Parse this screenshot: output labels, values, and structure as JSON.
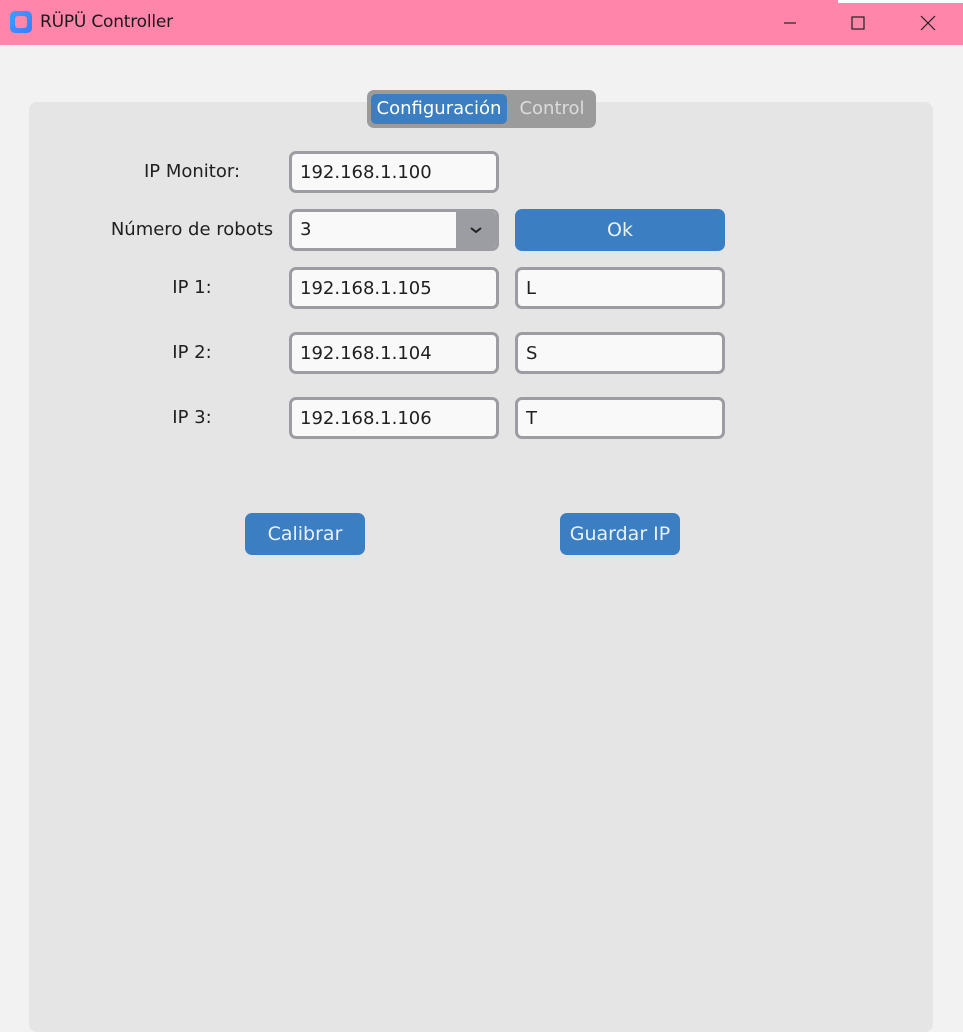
{
  "window": {
    "title": "RÜPÜ Controller",
    "icon": "app-icon",
    "controls": [
      "minimize-icon",
      "maximize-icon",
      "close-icon"
    ]
  },
  "tabs": {
    "active": "Configuración",
    "inactive": "Control"
  },
  "config": {
    "ip_monitor_label": "IP Monitor:",
    "ip_monitor_value": "192.168.1.100",
    "num_robots_label": "Número de robots",
    "num_robots_value": "3",
    "ok_label": "Ok",
    "robots": [
      {
        "label": "IP 1:",
        "ip": "192.168.1.105",
        "letter": "L"
      },
      {
        "label": "IP 2:",
        "ip": "192.168.1.104",
        "letter": "S"
      },
      {
        "label": "IP 3:",
        "ip": "192.168.1.106",
        "letter": "T"
      }
    ],
    "calibrate_label": "Calibrar",
    "save_ip_label": "Guardar IP"
  },
  "colors": {
    "titlebar": "#ff85ab",
    "accent": "#3b7ec1",
    "panel": "#e5e5e5",
    "field_border": "#9c9da2"
  }
}
